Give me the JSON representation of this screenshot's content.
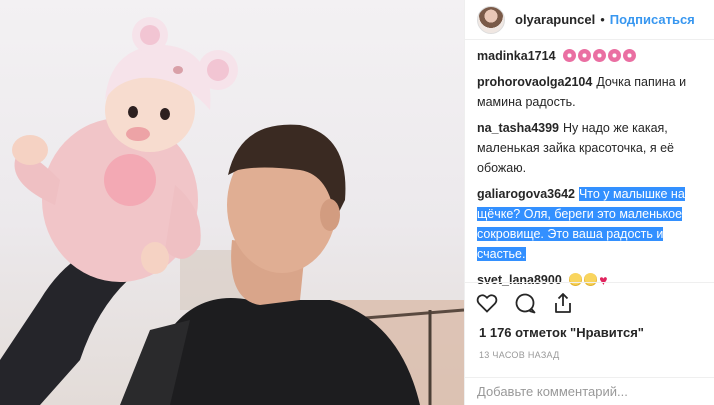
{
  "post": {
    "author": "olyarapuncel",
    "follow_label": "Подписаться",
    "separator": "•"
  },
  "comments": [
    {
      "user": "madinka1714",
      "text": "",
      "emoji": [
        "flower-emoji",
        "flower-emoji",
        "flower-emoji",
        "flower-emoji",
        "flower-emoji"
      ]
    },
    {
      "user": "prohorovaolga2104",
      "text": "Дочка папина и мамина радость."
    },
    {
      "user": "na_tasha4399",
      "text": "Ну надо же какая, маленькая зайка красоточка, я её обожаю."
    },
    {
      "user": "galiarogova3642",
      "text": "Что у малышке на щёчке? Оля, береги это маленькое сокровище. Это ваша радость и счастье."
    },
    {
      "user": "svet_lana8900",
      "text": "",
      "emoji": [
        "grin-emoji",
        "laugh-emoji",
        "heart-emoji"
      ]
    }
  ],
  "actions": {
    "like_icon": "heart-icon",
    "comment_icon": "comment-icon",
    "share_icon": "share-icon"
  },
  "likes_text": "1 176 отметок \"Нравится\"",
  "time_ago": "13 ЧАСОВ НАЗАД",
  "comment_input": {
    "placeholder": "Добавьте комментарий..."
  },
  "colors": {
    "accent": "#3897f0",
    "selection": "#3390ff",
    "heart": "#e0245e"
  }
}
